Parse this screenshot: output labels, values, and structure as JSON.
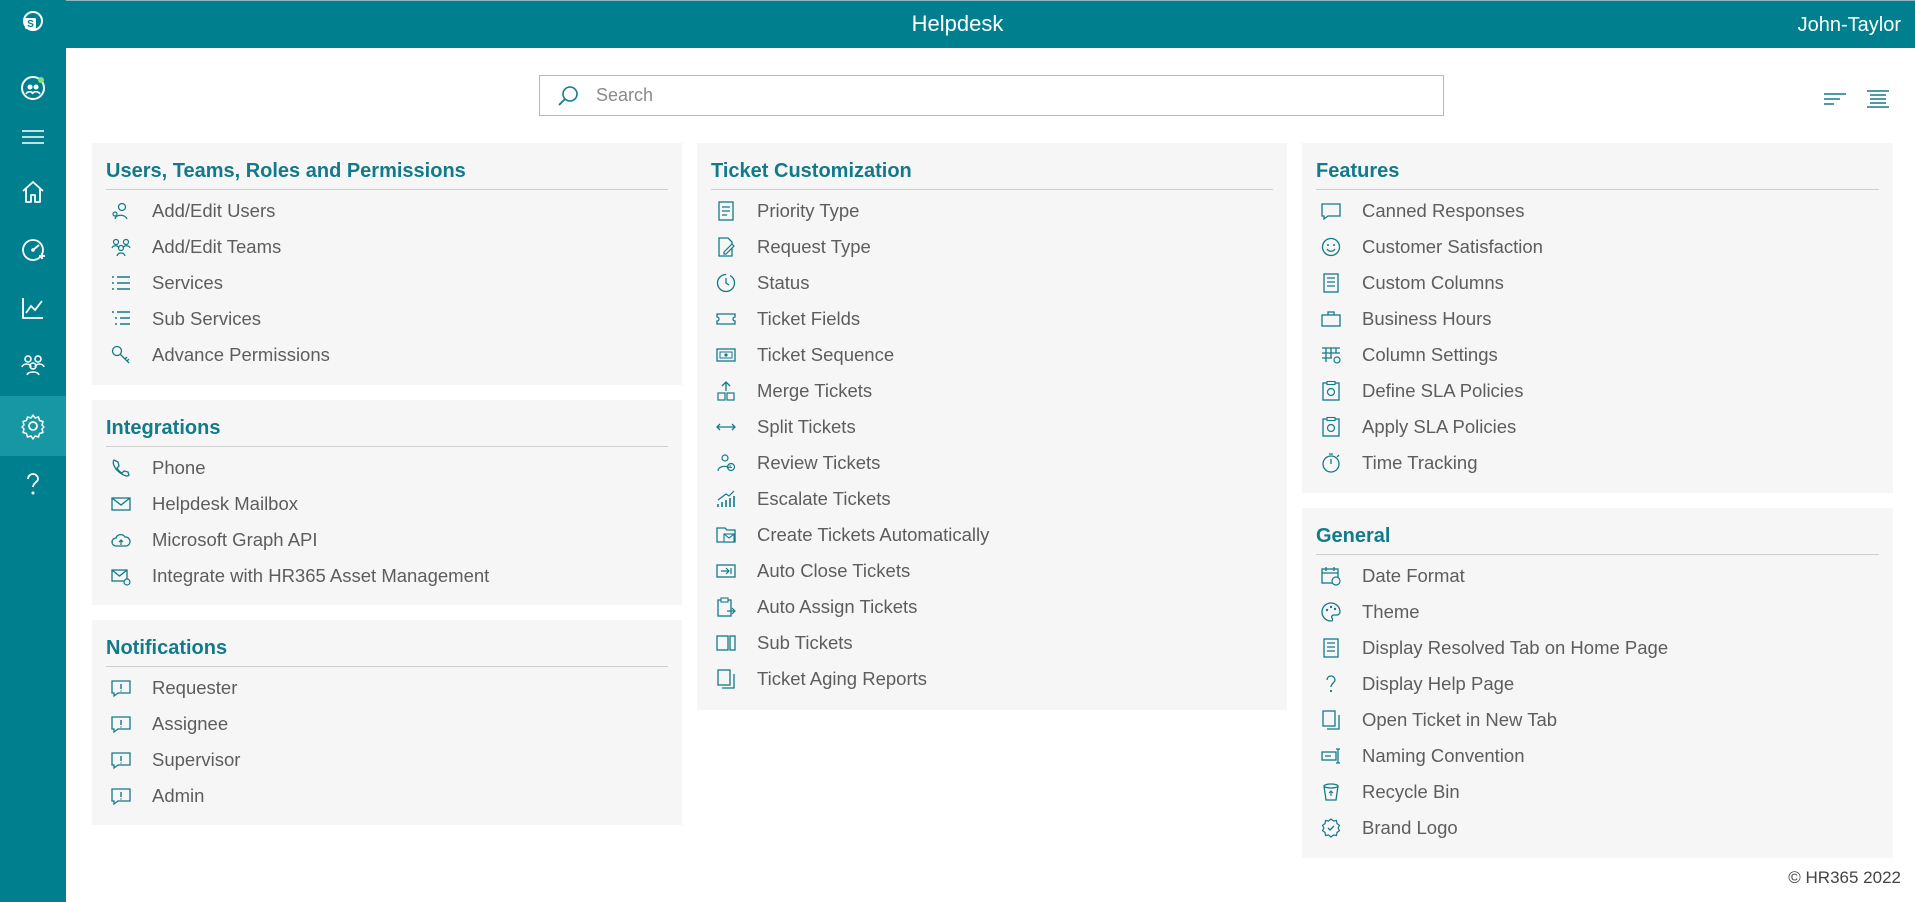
{
  "header": {
    "title": "Helpdesk",
    "user": "John-Taylor"
  },
  "sidebar": {
    "items": [
      {
        "name": "sharepoint-logo-icon"
      },
      {
        "name": "helpdesk-app-icon"
      },
      {
        "name": "hamburger-menu-icon"
      },
      {
        "name": "home-icon"
      },
      {
        "name": "dashboard-icon"
      },
      {
        "name": "reports-icon"
      },
      {
        "name": "team-icon"
      },
      {
        "name": "settings-icon"
      },
      {
        "name": "help-icon"
      }
    ],
    "active": "settings-icon"
  },
  "search": {
    "placeholder": "Search",
    "value": ""
  },
  "sections": {
    "users": {
      "title": "Users, Teams, Roles and Permissions",
      "items": [
        "Add/Edit Users",
        "Add/Edit Teams",
        "Services",
        "Sub Services",
        "Advance Permissions"
      ]
    },
    "integrations": {
      "title": "Integrations",
      "items": [
        "Phone",
        "Helpdesk Mailbox",
        "Microsoft Graph API",
        "Integrate with HR365 Asset Management"
      ]
    },
    "notifications": {
      "title": "Notifications",
      "items": [
        "Requester",
        "Assignee",
        "Supervisor",
        "Admin"
      ]
    },
    "ticket": {
      "title": "Ticket Customization",
      "items": [
        "Priority Type",
        "Request Type",
        "Status",
        "Ticket Fields",
        "Ticket Sequence",
        "Merge Tickets",
        "Split Tickets",
        "Review Tickets",
        "Escalate Tickets",
        "Create Tickets Automatically",
        "Auto Close Tickets",
        "Auto Assign Tickets",
        "Sub Tickets",
        "Ticket Aging Reports"
      ]
    },
    "features": {
      "title": "Features",
      "items": [
        "Canned Responses",
        "Customer Satisfaction",
        "Custom Columns",
        "Business Hours",
        "Column Settings",
        "Define SLA Policies",
        "Apply SLA Policies",
        "Time Tracking"
      ]
    },
    "general": {
      "title": "General",
      "items": [
        "Date Format",
        "Theme",
        "Display Resolved Tab on Home Page",
        "Display Help Page",
        "Open Ticket in New Tab",
        "Naming Convention",
        "Recycle Bin",
        "Brand Logo"
      ]
    }
  },
  "footer": {
    "copyright": "© HR365 2022"
  },
  "colors": {
    "accent": "#00808f",
    "sidebar_active": "#1796a4",
    "section_title": "#137a89",
    "card_bg": "#f6f6f6"
  }
}
